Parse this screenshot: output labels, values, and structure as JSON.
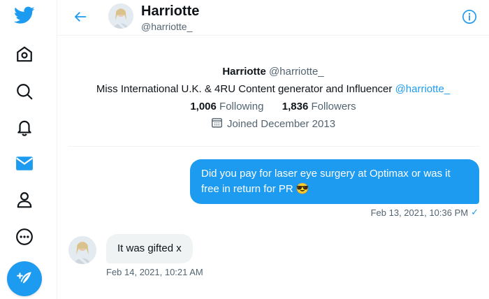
{
  "colors": {
    "accent": "#1d9bf0",
    "text": "#0f1419",
    "muted": "#536471",
    "border": "#eff3f4"
  },
  "sidebar": {
    "items": [
      {
        "icon": "twitter-logo-icon"
      },
      {
        "icon": "home-icon"
      },
      {
        "icon": "search-icon"
      },
      {
        "icon": "bell-icon"
      },
      {
        "icon": "mail-icon",
        "active": true
      },
      {
        "icon": "profile-icon"
      },
      {
        "icon": "more-icon"
      }
    ],
    "compose_icon": "compose-tweet-icon"
  },
  "header": {
    "name": "Harriotte",
    "handle": "@harriotte_"
  },
  "profile": {
    "name": "Harriotte",
    "handle": "@harriotte_",
    "bio": "Miss International U.K. & 4RU Content generator and Influencer",
    "bio_mention": "@harriotte_",
    "following_count": "1,006",
    "following_label": "Following",
    "followers_count": "1,836",
    "followers_label": "Followers",
    "joined": "Joined December 2013"
  },
  "messages": [
    {
      "direction": "outgoing",
      "text": "Did you pay for laser eye surgery at Optimax or was it free in return for PR 😎",
      "timestamp": "Feb 13, 2021, 10:36 PM",
      "status": "✓"
    },
    {
      "direction": "incoming",
      "text": "It was gifted x",
      "timestamp": "Feb 14, 2021, 10:21 AM"
    }
  ]
}
